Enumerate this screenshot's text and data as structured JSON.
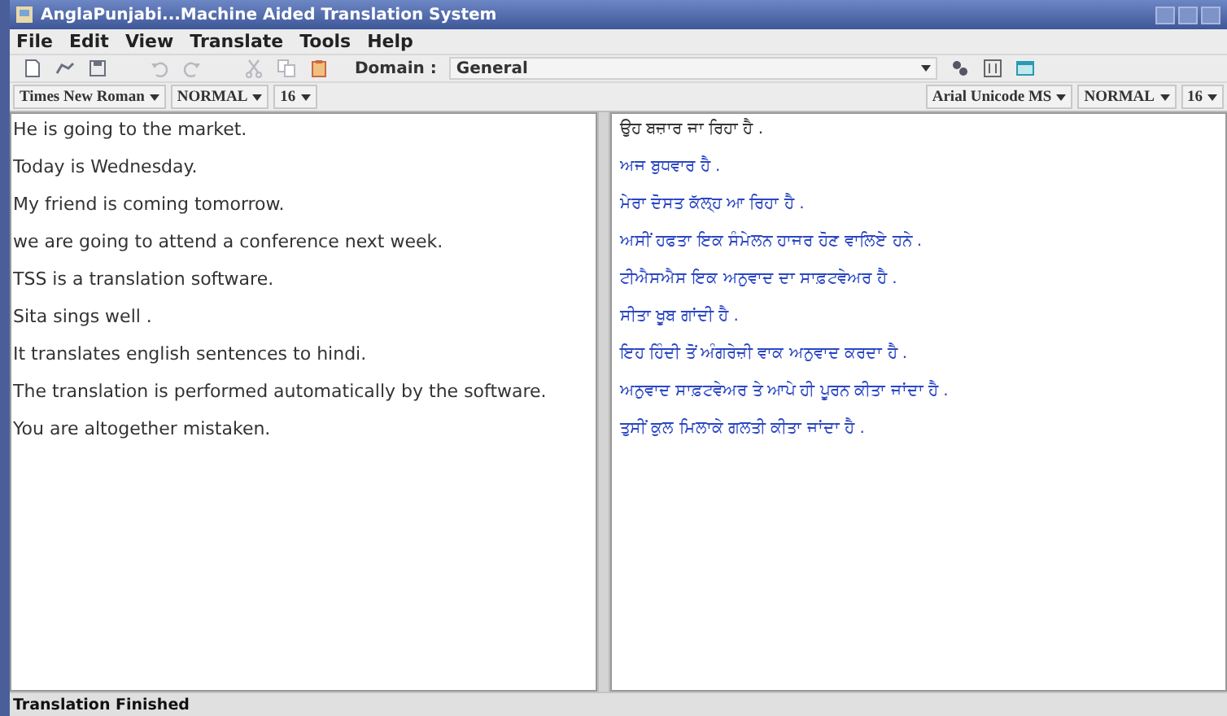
{
  "window": {
    "title": "AnglaPunjabi...Machine Aided Translation System"
  },
  "menu": [
    "File",
    "Edit",
    "View",
    "Translate",
    "Tools",
    "Help"
  ],
  "toolbar": [
    {
      "kind": "new",
      "disabled": false
    },
    {
      "kind": "open",
      "disabled": false
    },
    {
      "kind": "save",
      "disabled": false
    },
    {
      "kind": "undo",
      "disabled": true
    },
    {
      "kind": "redo",
      "disabled": true
    },
    {
      "kind": "cut",
      "disabled": true
    },
    {
      "kind": "copy",
      "disabled": true
    },
    {
      "kind": "paste",
      "disabled": false
    }
  ],
  "domain": {
    "label": "Domain :",
    "value": "General"
  },
  "source_font": {
    "family": "Times New Roman",
    "style": "NORMAL",
    "size": "16"
  },
  "target_font": {
    "family": "Arial Unicode MS",
    "style": "NORMAL",
    "size": "16"
  },
  "source_lines": [
    "He is going to the market.",
    "Today is Wednesday.",
    "My friend is coming tomorrow.",
    "we are going to attend a conference next week.",
    "TSS is a translation software.",
    "Sita sings well .",
    "It translates english sentences to hindi.",
    "The translation is performed automatically by the software.",
    "You are altogether mistaken."
  ],
  "target_lines": [
    {
      "text": "ਉਹ ਬਜ਼ਾਰ ਜਾ ਰਿਹਾ ਹੈ .",
      "selected": true
    },
    {
      "text": "ਅਜ ਬੁਧਵਾਰ ਹੈ .",
      "selected": false
    },
    {
      "text": "ਮੇਰਾ ਦੋਸਤ ਕੱਲ੍ਹ ਆ ਰਿਹਾ ਹੈ .",
      "selected": false
    },
    {
      "text": "ਅਸੀਂ ਹਫਤਾ ਇਕ ਸੰਮੇਲਨ ਹਾਜਰ ਹੋਣ ਵਾਲਿਏ ਹਨੇ .",
      "selected": false
    },
    {
      "text": "ਟੀਐਸਐਸ ਇਕ ਅਨੁਵਾਦ ਦਾ ਸਾਫ਼ਟਵੇਅਰ ਹੈ .",
      "selected": false
    },
    {
      "text": "ਸੀਤਾ ਖੂਬ ਗਾਂਦੀ ਹੈ .",
      "selected": false
    },
    {
      "text": "ਇਹ ਹਿੰਦੀ ਤੋਂ ਅੰਗਰੇਜ਼ੀ ਵਾਕ ਅਨੁਵਾਦ ਕਰਦਾ ਹੈ .",
      "selected": false
    },
    {
      "text": "ਅਨੁਵਾਦ ਸਾਫ਼ਟਵੇਅਰ ਤੇ ਆਪੇ ਹੀ  ਪੂਰਨ ਕੀਤਾ ਜਾਂਦਾ ਹੈ .",
      "selected": false
    },
    {
      "text": "ਤੁਸੀਂ ਕੁਲ ਮਿਲਾਕੇ ਗਲਤੀ ਕੀਤਾ ਜਾਂਦਾ ਹੈ .",
      "selected": false
    }
  ],
  "status_bar": {
    "text": "Translation Finished"
  }
}
